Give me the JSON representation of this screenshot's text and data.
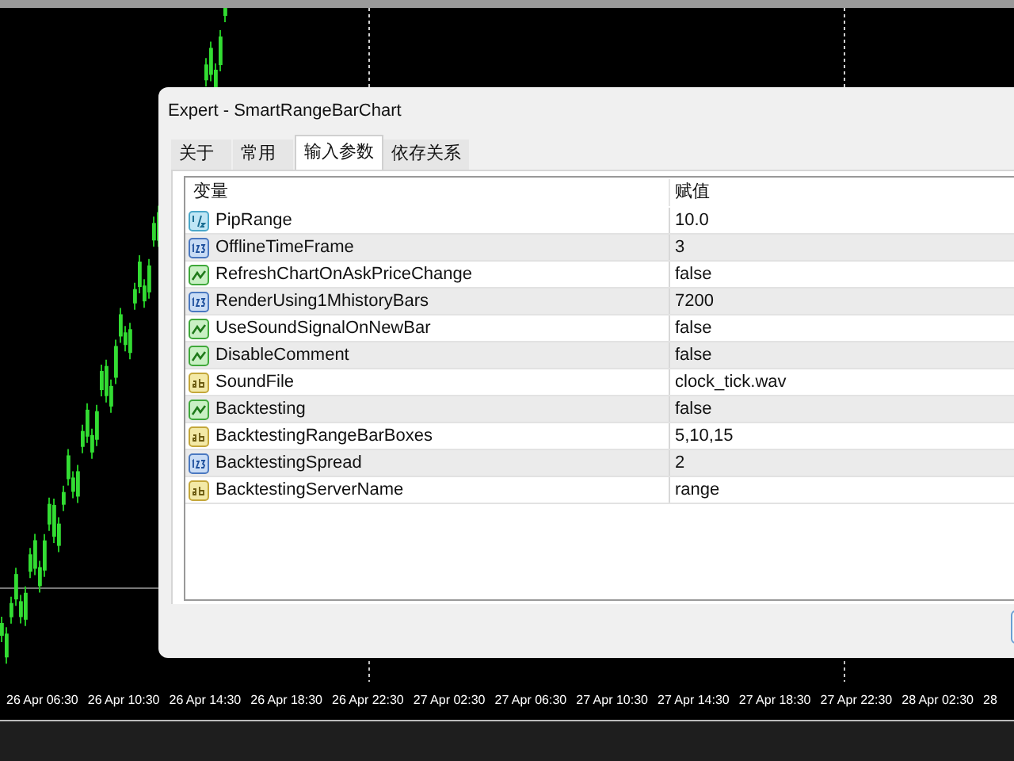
{
  "chart": {
    "time_axis": [
      "26 Apr 06:30",
      "26 Apr 10:30",
      "26 Apr 14:30",
      "26 Apr 18:30",
      "26 Apr 22:30",
      "27 Apr 02:30",
      "27 Apr 06:30",
      "27 Apr 10:30",
      "27 Apr 14:30",
      "27 Apr 18:30",
      "27 Apr 22:30",
      "28 Apr 02:30",
      "28"
    ]
  },
  "window": {
    "title": "Expert - SmartRangeBarChart"
  },
  "tabs": [
    {
      "label": "关于",
      "selected": false
    },
    {
      "label": "常用",
      "selected": false
    },
    {
      "label": "输入参数",
      "selected": true
    },
    {
      "label": "依存关系",
      "selected": false
    }
  ],
  "table": {
    "columns": [
      "变量",
      "赋值"
    ],
    "rows": [
      {
        "kind": "double",
        "name": "PipRange",
        "value": "10.0"
      },
      {
        "kind": "int",
        "name": "OfflineTimeFrame",
        "value": "3"
      },
      {
        "kind": "bool",
        "name": "RefreshChartOnAskPriceChange",
        "value": "false"
      },
      {
        "kind": "int",
        "name": "RenderUsing1MhistoryBars",
        "value": "7200"
      },
      {
        "kind": "bool",
        "name": "UseSoundSignalOnNewBar",
        "value": "false"
      },
      {
        "kind": "bool",
        "name": "DisableComment",
        "value": "false"
      },
      {
        "kind": "string",
        "name": "SoundFile",
        "value": "clock_tick.wav"
      },
      {
        "kind": "bool",
        "name": "Backtesting",
        "value": "false"
      },
      {
        "kind": "string",
        "name": "BacktestingRangeBarBoxes",
        "value": "5,10,15"
      },
      {
        "kind": "int",
        "name": "BacktestingSpread",
        "value": "2"
      },
      {
        "kind": "string",
        "name": "BacktestingServerName",
        "value": "range"
      }
    ]
  }
}
